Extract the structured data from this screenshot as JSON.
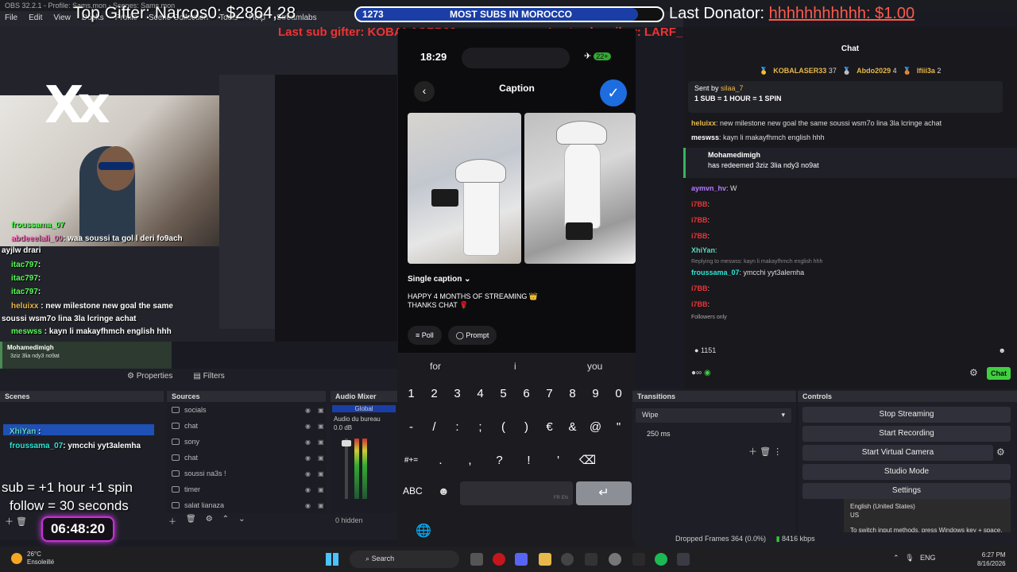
{
  "window": {
    "title": "OBS 32.2.1 - Profile: Sams.mon - Scenes: Sams.mon"
  },
  "menu": [
    "File",
    "Edit",
    "View",
    "Docks",
    "Profile",
    "Scene Collection",
    "Tools",
    "Help",
    "Streamlabs"
  ],
  "overlay": {
    "top_gifter": "Top Gifter: Narcos0: $2864,28",
    "goal_count": "1273",
    "goal_title": "MOST SUBS IN MOROCCO",
    "goal_progress": 0.92,
    "last_donator_label": "Last Donator: ",
    "last_donator_value": "hhhhhhhhhhh: $1.00",
    "last_sub_gifter": "Last sub gifter: KOBALASER33",
    "last_subscriber": "Last subscriber: LARF_chidou_y",
    "logo": "Xx",
    "sub_rule": "sub  = +1 hour +1 spin",
    "follow_rule": "follow = 30 seconds",
    "timer": "06:48:20"
  },
  "left_chat": [
    {
      "user": "froussama_07",
      "msg": ""
    },
    {
      "user": "abdeeelali_00",
      "msg": "waa soussi ta gol l deri fo9ach"
    },
    {
      "user": "ayjlw drari",
      "msg": ""
    },
    {
      "user": "itac797",
      "msg": ""
    },
    {
      "user": "itac797",
      "msg": ""
    },
    {
      "user": "itac797",
      "msg": ""
    },
    {
      "user": "heluixx",
      "msg": "new milestone new goal the same"
    },
    {
      "user": "",
      "msg": "soussi wsm7o lina 3la lcringe achat"
    },
    {
      "user": "meswss",
      "msg": "kayn li makayfhmch english hhh"
    }
  ],
  "left_redeem": {
    "user": "Mohamedimigh",
    "text": "3ziz 3lia ndy3 no9at"
  },
  "dock_tabs": [
    "Properties",
    "Filters"
  ],
  "docks": {
    "scenes": "Scenes",
    "sources": "Sources",
    "audio_mixer": "Audio Mixer",
    "transitions": "Transitions",
    "controls": "Controls"
  },
  "sources": [
    "socials",
    "chat",
    "sony",
    "chat",
    "soussi na3s !",
    "timer",
    "salat lianaza"
  ],
  "audio": {
    "tab": "Global",
    "device": "Audio du bureau",
    "db": "0.0 dB",
    "hidden": "0 hidden"
  },
  "phone": {
    "time": "18:29",
    "battery": "22+",
    "title": "Caption",
    "caption_mode": "Single caption",
    "caption_text": "HAPPY 4 MONTHS OF STREAMING 👑\nTHANKS CHAT 🌹",
    "btn_poll": "Poll",
    "btn_prompt": "Prompt",
    "suggestions": [
      "for",
      "i",
      "you"
    ],
    "row_numbers": [
      "1",
      "2",
      "3",
      "4",
      "5",
      "6",
      "7",
      "8",
      "9",
      "0"
    ],
    "row_symbols": [
      "-",
      "/",
      ":",
      ";",
      "(",
      ")",
      "€",
      "&",
      "@",
      "\""
    ],
    "row_misc": [
      "#+=",
      ".",
      ",",
      "?",
      "!",
      "'"
    ],
    "abc": "ABC",
    "space_hint": "FR EN"
  },
  "transitions": {
    "type": "Wipe",
    "duration": "250 ms"
  },
  "controls": [
    "Stop Streaming",
    "Start Recording",
    "Start Virtual Camera",
    "Studio Mode",
    "Settings"
  ],
  "right_chat": {
    "title": "Chat",
    "leaders": [
      {
        "name": "KOBALASER33",
        "n": "37"
      },
      {
        "name": "Abdo2029",
        "n": "4"
      },
      {
        "name": "lfiii3a",
        "n": "2"
      }
    ],
    "pinned_by": "Sent by",
    "pinned_user": "silaa_7",
    "pinned_text": "1 SUB = 1 HOUR = 1 SPIN",
    "lines": [
      {
        "user": "heluixx",
        "msg": ": new milestone new goal the same soussi wsm7o lina 3la lcringe achat",
        "color": "#e8b84a"
      },
      {
        "user": "meswss",
        "msg": ": kayn li makayfhmch english hhh",
        "color": "#ffffff"
      }
    ],
    "redeem_user": "Mohamedimigh",
    "redeem_text": "has redeemed 3ziz 3lia ndy3 no9at",
    "lines2": [
      {
        "user": "aymvn_hv",
        "msg": ": W",
        "color": "#b97bff"
      },
      {
        "user": "i7BB",
        "msg": ": ",
        "color": "#e33"
      },
      {
        "user": "i7BB",
        "msg": ": ",
        "color": "#e33"
      },
      {
        "user": "i7BB",
        "msg": ": ",
        "color": "#e33"
      },
      {
        "user": "XhiYan",
        "msg": ":",
        "color": "#5fd6c0"
      }
    ],
    "reply_note": "Replying to meswss: kayn li makayfhmch english hhh",
    "lines3": [
      {
        "user": "froussama_07",
        "msg": ": ymcchi yyt3alemha",
        "color": "#2ee6d6"
      },
      {
        "user": "i7BB",
        "msg": ": ",
        "color": "#e33"
      },
      {
        "user": "i7BB",
        "msg": ": ",
        "color": "#e33"
      }
    ],
    "followers_only": "Followers only",
    "input_value": "1151",
    "send": "Chat"
  },
  "lang_popup": {
    "lang": "English (United States)",
    "layout": "US",
    "hint": "To switch input methods, press Windows key + space."
  },
  "status": {
    "dropped": "Dropped Frames 364 (0.0%)",
    "kbps": "8416 kbps"
  },
  "taskbar": {
    "temp": "26°C",
    "weather": "Ensoleillé",
    "search": "Search",
    "lang": "ENG",
    "time": "6:27 PM",
    "date": "8/16/2026"
  }
}
